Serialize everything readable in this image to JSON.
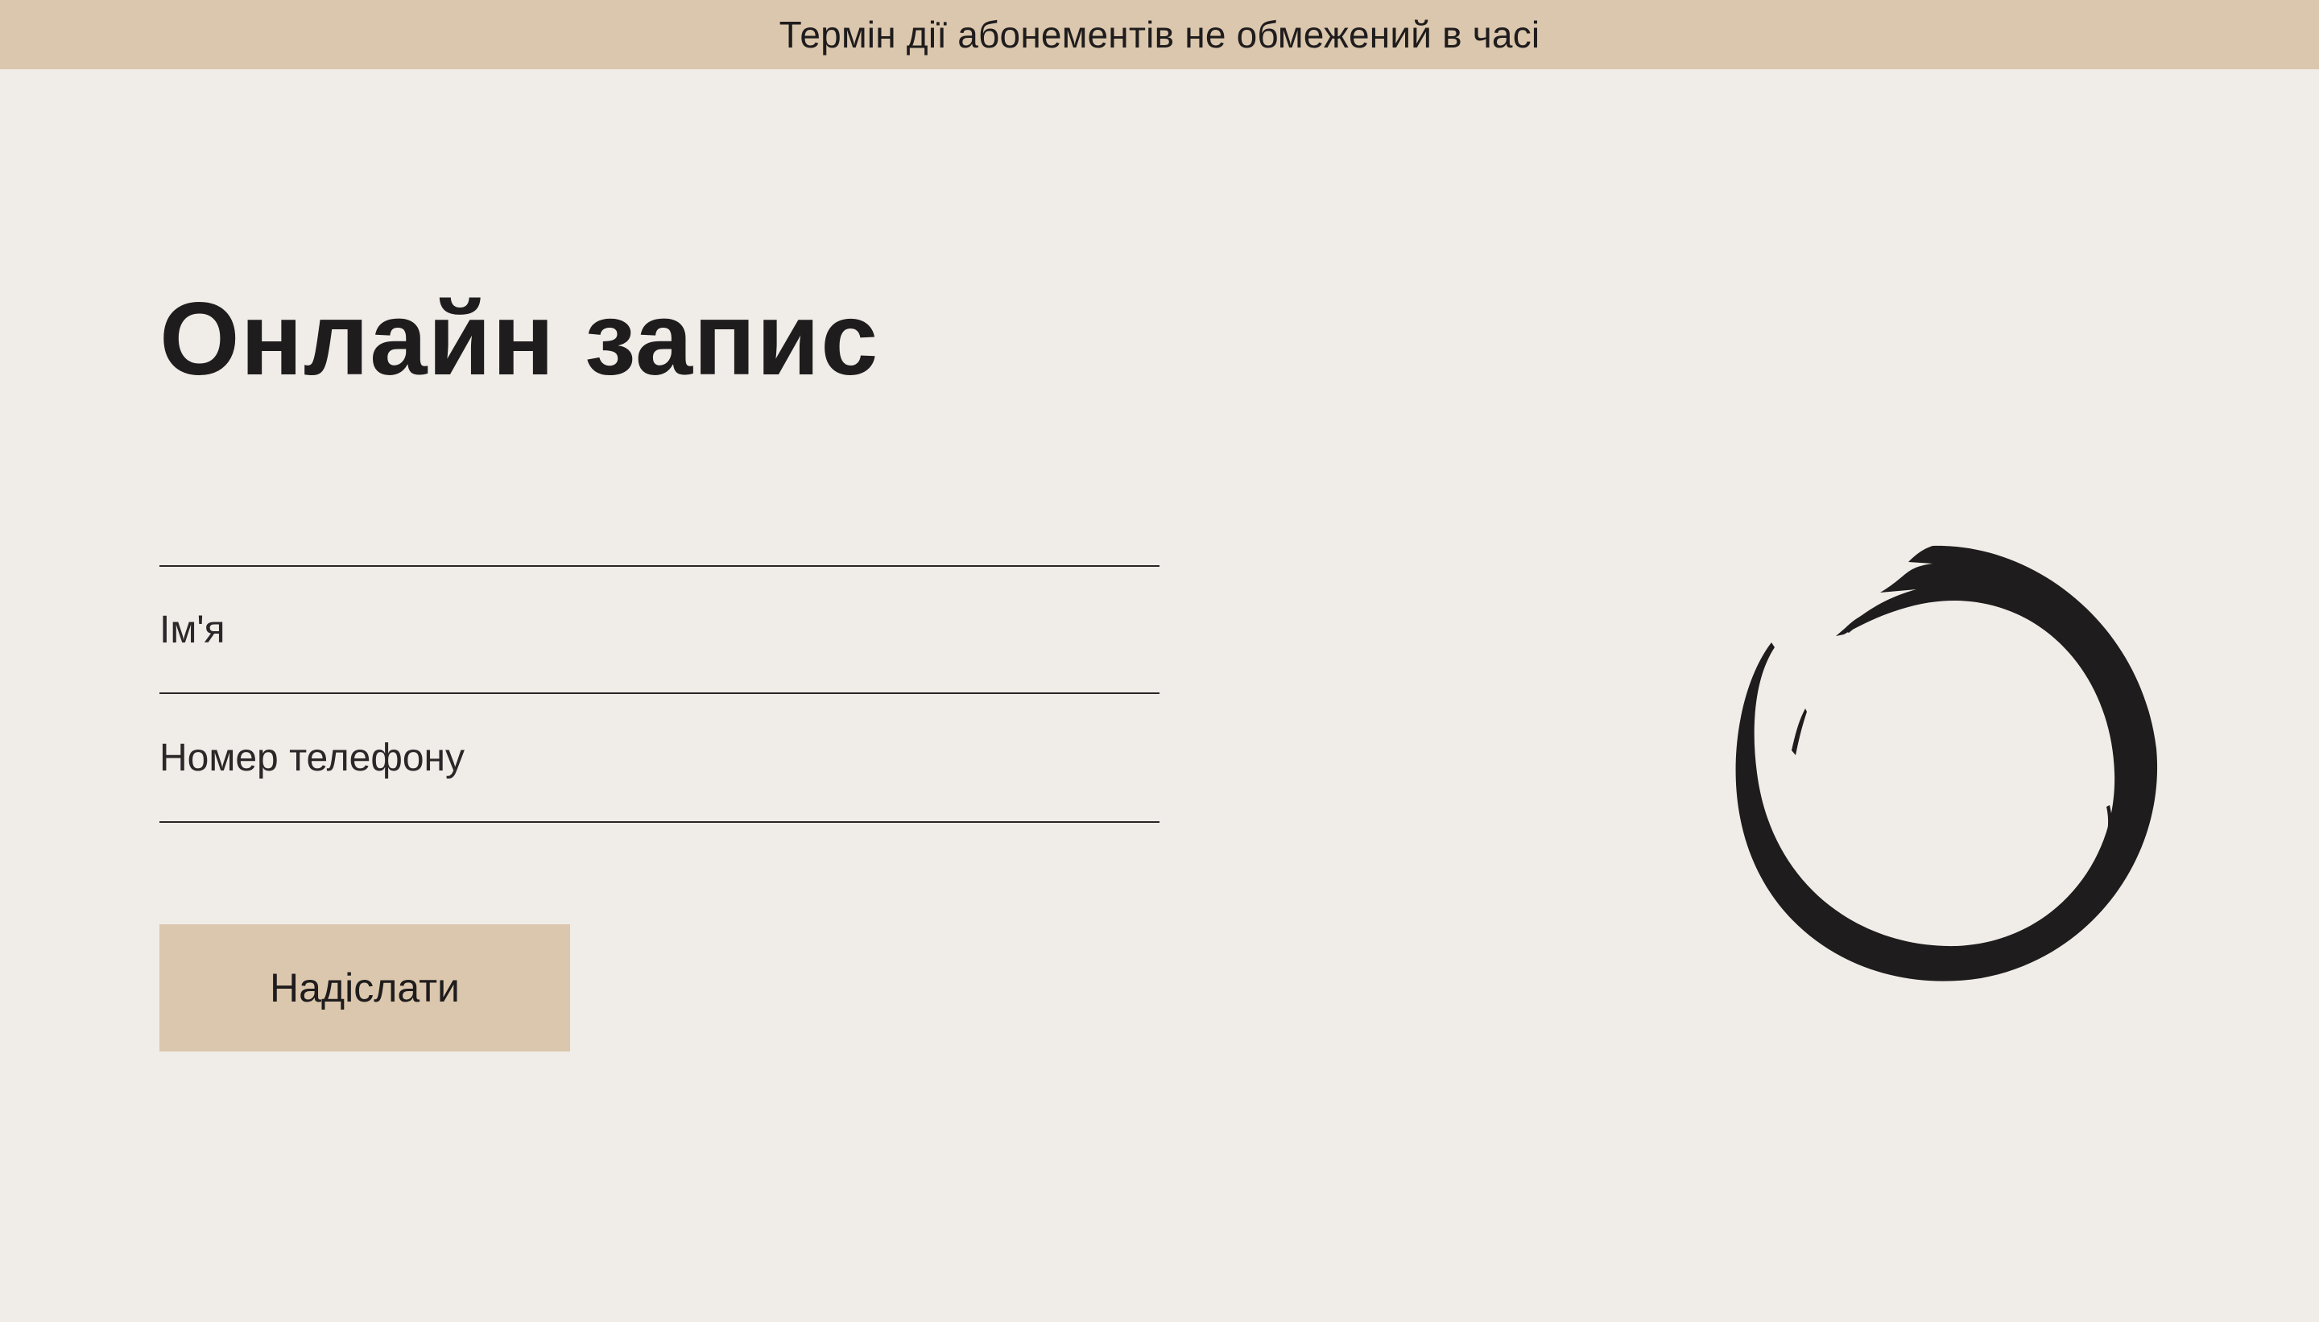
{
  "banner": {
    "text": "Термін дії абонементів не обмежений в часі"
  },
  "form": {
    "title": "Онлайн запис",
    "name_placeholder": "Ім'я",
    "phone_placeholder": "Номер телефону",
    "submit_label": "Надіслати"
  },
  "decoration": {
    "icon": "enso-circle-icon"
  },
  "colors": {
    "background": "#f0ece8",
    "accent": "#dbc7ad",
    "text": "#1f1c1d"
  }
}
